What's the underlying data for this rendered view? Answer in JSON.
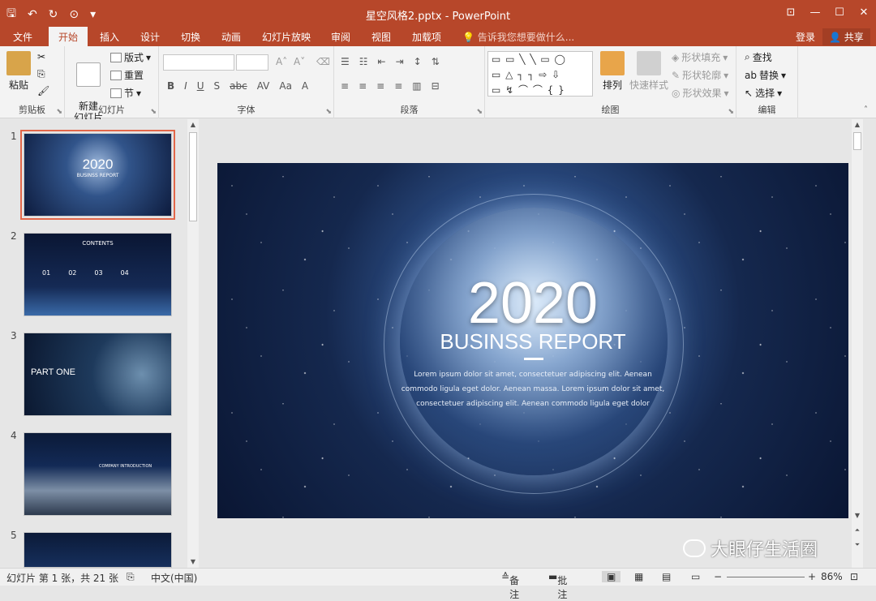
{
  "window": {
    "title": "星空风格2.pptx - PowerPoint"
  },
  "ribbon_tabs": [
    "文件",
    "开始",
    "插入",
    "设计",
    "切换",
    "动画",
    "幻灯片放映",
    "审阅",
    "视图",
    "加载项"
  ],
  "tell_me": "告诉我您想要做什么...",
  "account": {
    "login": "登录",
    "share": "共享"
  },
  "ribbon": {
    "clipboard": {
      "label": "剪贴板",
      "paste": "粘贴"
    },
    "slides": {
      "label": "幻灯片",
      "new_slide": "新建\n幻灯片",
      "layout": "版式",
      "reset": "重置",
      "section": "节"
    },
    "font": {
      "label": "字体"
    },
    "paragraph": {
      "label": "段落"
    },
    "drawing": {
      "label": "绘图",
      "arrange": "排列",
      "quick_styles": "快速样式",
      "shape_fill": "形状填充",
      "shape_outline": "形状轮廓",
      "shape_effects": "形状效果"
    },
    "editing": {
      "label": "编辑",
      "find": "查找",
      "replace": "替换",
      "select": "选择"
    }
  },
  "thumbnails": [
    {
      "num": "1",
      "title": "2020",
      "subtitle": "BUSINSS REPORT"
    },
    {
      "num": "2",
      "title": "CONTENTS",
      "items": [
        "01",
        "02",
        "03",
        "04"
      ]
    },
    {
      "num": "3",
      "title": "PART ONE"
    },
    {
      "num": "4",
      "title": "COMPANY INTRODUCTION"
    },
    {
      "num": "5",
      "title": ""
    }
  ],
  "slide": {
    "year": "2020",
    "subtitle": "BUSINSS REPORT",
    "body": "Lorem ipsum dolor sit amet, consectetuer adipiscing elit. Aenean commodo ligula eget dolor. Aenean massa. Lorem ipsum dolor sit amet, consectetuer adipiscing elit. Aenean commodo ligula eget dolor"
  },
  "status": {
    "slide_info": "幻灯片 第 1 张，共 21 张",
    "language": "中文(中国)",
    "notes": "备注",
    "comments": "批注",
    "zoom": "86%"
  },
  "watermark": "大眼仔生活圈"
}
